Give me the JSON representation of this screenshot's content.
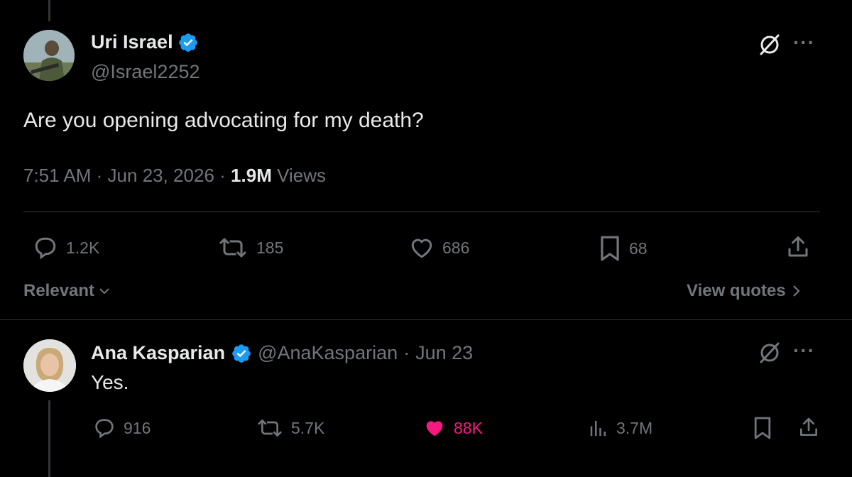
{
  "main_tweet": {
    "author_name": "Uri Israel",
    "author_handle": "@Israel2252",
    "text": "Are you opening advocating for my death?",
    "time": "7:51 AM",
    "date": "Jun 23, 2026",
    "views_count": "1.9M",
    "views_label": "Views",
    "separator": "·",
    "actions": {
      "replies": "1.2K",
      "reposts": "185",
      "likes": "686",
      "bookmarks": "68"
    }
  },
  "sort": {
    "label": "Relevant",
    "quotes_link": "View quotes"
  },
  "reply": {
    "author_name": "Ana Kasparian",
    "author_handle": "@AnaKasparian",
    "date": "Jun 23",
    "separator": "·",
    "text": "Yes.",
    "actions": {
      "replies": "916",
      "reposts": "5.7K",
      "likes": "88K",
      "views": "3.7M"
    }
  },
  "icons": {
    "verified": "verified-badge-icon",
    "grok": "grok-icon",
    "more": "more-icon",
    "reply": "reply-icon",
    "repost": "repost-icon",
    "like": "heart-icon",
    "bookmark": "bookmark-icon",
    "share": "share-icon",
    "analytics": "analytics-icon",
    "chevron": "chevron-icon"
  },
  "colors": {
    "background": "#000000",
    "text": "#e7e9ea",
    "muted": "#71767b",
    "verified": "#1d9bf0",
    "like_active": "#f91880"
  }
}
